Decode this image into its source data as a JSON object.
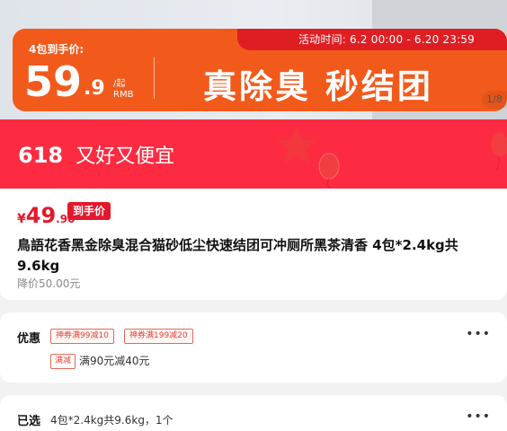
{
  "promo": {
    "pack_label": "4包到手价:",
    "price_int": "59",
    "price_dec": ".9",
    "unit_top": "/起",
    "unit_bottom": "RMB",
    "slogan": "真除臭 秒结团",
    "event_time": "活动时间: 6.2 00:00 - 6.20 23:59",
    "page_indicator": "1/8"
  },
  "banner": {
    "num": "618",
    "text": "又好又便宜"
  },
  "product": {
    "currency": "¥",
    "price_int": "49",
    "price_dec": ".90",
    "price_tag": "到手价",
    "title": "鳥語花香黑金除臭混合猫砂低尘快速结团可冲厕所黑茶清香 4包*2.4kg共9.6kg",
    "orig_price": "降价50.00元"
  },
  "offers": {
    "label": "优惠",
    "coupons": [
      "神券满99减10",
      "神券满199减20"
    ],
    "mini_tag": "满减",
    "text": "满90元减40元",
    "more_icon": "more-dots-icon"
  },
  "selected": {
    "label": "已选",
    "value": "4包*2.4kg共9.6kg，1个"
  },
  "colors": {
    "promo_orange": "#f25a1c",
    "promo_red": "#df1e23",
    "banner_red": "#fd2b41",
    "price_red": "#e4182c"
  }
}
